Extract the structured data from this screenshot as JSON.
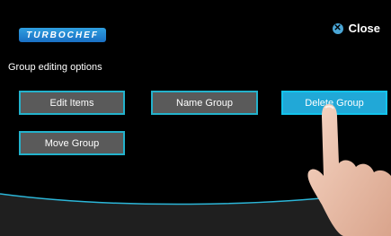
{
  "brand": {
    "logo_text": "TURBOCHEF"
  },
  "header": {
    "close_label": "Close",
    "close_icon": "x-icon"
  },
  "section": {
    "heading": "Group editing options"
  },
  "buttons": {
    "edit_items": "Edit Items",
    "name_group": "Name Group",
    "delete_group": "Delete Group",
    "move_group": "Move Group"
  },
  "colors": {
    "accent": "#23b2cc",
    "active": "#21a8d7",
    "button_bg": "#5a5a5a",
    "logo": "#1a6fc4"
  }
}
